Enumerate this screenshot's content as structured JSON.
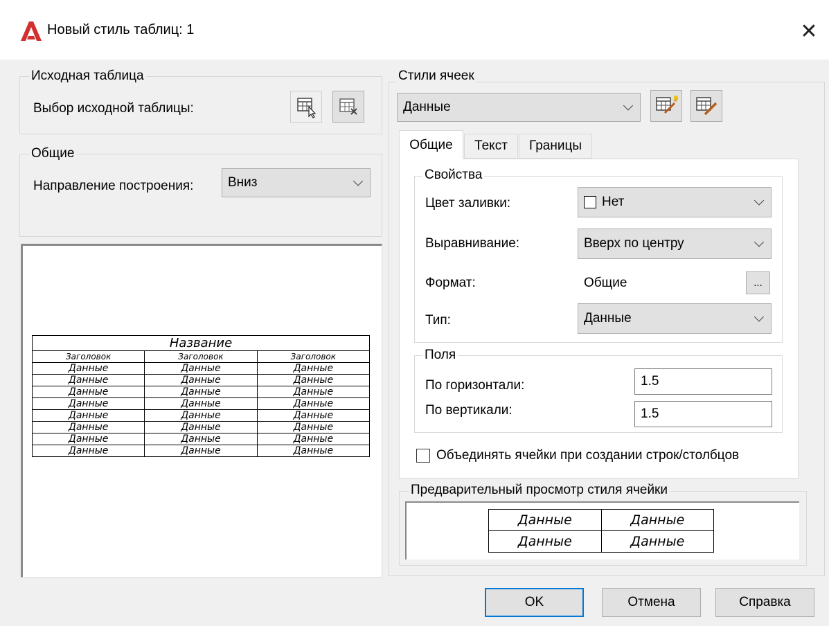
{
  "window": {
    "title": "Новый стиль таблиц: 1",
    "close_glyph": "✕",
    "logo_icon": "autocad-logo-icon"
  },
  "source_table": {
    "group_label": "Исходная таблица",
    "select_label": "Выбор исходной таблицы:"
  },
  "general": {
    "group_label": "Общие",
    "direction_label": "Направление построения:",
    "direction_value": "Вниз"
  },
  "preview_table": {
    "title": "Название",
    "headers": [
      "Заголовок",
      "Заголовок",
      "Заголовок"
    ],
    "data_cell": "Данные",
    "rows": 8
  },
  "cell_styles": {
    "group_label": "Стили ячеек",
    "selected": "Данные"
  },
  "tabs": [
    {
      "label": "Общие",
      "active": true
    },
    {
      "label": "Текст",
      "active": false
    },
    {
      "label": "Границы",
      "active": false
    }
  ],
  "properties": {
    "group_label": "Свойства",
    "fill_label": "Цвет заливки:",
    "fill_value": "Нет",
    "align_label": "Выравнивание:",
    "align_value": "Вверх по центру",
    "format_label": "Формат:",
    "format_value": "Общие",
    "format_button": "...",
    "type_label": "Тип:",
    "type_value": "Данные"
  },
  "margins": {
    "group_label": "Поля",
    "horizontal_label": "По горизонтали:",
    "horizontal_value": "1.5",
    "vertical_label": "По вертикали:",
    "vertical_value": "1.5"
  },
  "merge_checkbox": {
    "label": "Объединять ячейки при создании строк/столбцов",
    "checked": false
  },
  "cell_preview": {
    "group_label": "Предварительный просмотр стиля ячейки",
    "cells": [
      [
        "Данные",
        "Данные"
      ],
      [
        "Данные",
        "Данные"
      ]
    ]
  },
  "buttons": {
    "ok": "OK",
    "cancel": "Отмена",
    "help": "Справка"
  },
  "colors": {
    "accent": "#0078d7",
    "logo_red": "#d32f2f"
  }
}
